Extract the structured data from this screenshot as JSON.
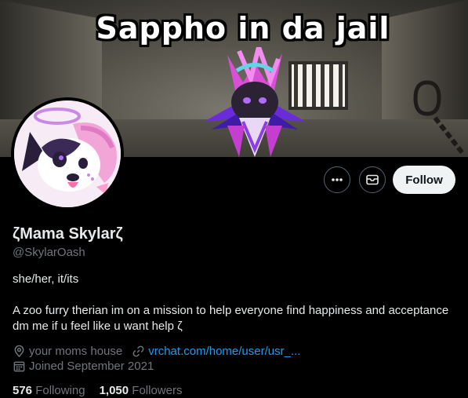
{
  "banner": {
    "caption": "Sappho in da jail"
  },
  "profile": {
    "display_name": "ζMama Skylarζ",
    "handle": "@SkylarOash",
    "bio_line1": "she/her, it/its",
    "bio_line2": "A zoo furry therian  im on a mission to  help everyone  find happiness and acceptance  dm  me if u  feel like  u want help  ζ",
    "location": "your moms house",
    "website": "vrchat.com/home/user/usr_...",
    "joined": "Joined September 2021"
  },
  "actions": {
    "follow_label": "Follow"
  },
  "stats": {
    "following_count": "576",
    "following_label": "Following",
    "followers_count": "1,050",
    "followers_label": "Followers"
  },
  "icons": {
    "more": "more-icon",
    "message": "envelope-icon",
    "location": "location-pin-icon",
    "website": "link-icon",
    "joined": "calendar-icon"
  },
  "colors": {
    "background": "#000000",
    "text_primary": "#e7e9ea",
    "text_secondary": "#71767b",
    "link": "#1d9bf0",
    "follow_button_bg": "#eff3f4",
    "button_border": "#536471"
  }
}
